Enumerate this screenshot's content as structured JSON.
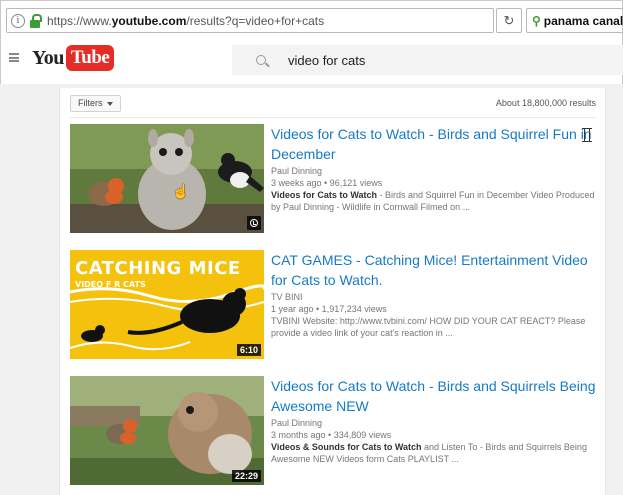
{
  "browser": {
    "url_prefix": "https://www.",
    "url_domain": "youtube.com",
    "url_path": "/results?q=video+for+cats",
    "reload_glyph": "↻",
    "search_value": "panama canal",
    "icons": [
      "info-icon",
      "lock-icon",
      "reload-icon",
      "search-engine-icon"
    ]
  },
  "header": {
    "logo_you": "You",
    "logo_tube": "Tube",
    "search_query": "video for cats"
  },
  "toolbar": {
    "filters_label": "Filters",
    "results_count": "About 18,800,000 results"
  },
  "results": [
    {
      "title": "Videos for Cats to Watch - Birds and Squirrel Fun in December",
      "channel": "Paul Dinning",
      "meta": "3 weeks ago • 96,121 views",
      "desc_hl": "Videos for Cats to Watch",
      "desc_rest": " - Birds and Squirrel Fun in December Video Produced by Paul Dinning - Wildlife in Cornwall Filmed on ...",
      "duration": "",
      "thumb_text1": "",
      "thumb_text2": ""
    },
    {
      "title": "CAT GAMES - Catching Mice! Entertainment Video for Cats to Watch.",
      "channel": "TV BINI",
      "meta": "1 year ago • 1,917,234 views",
      "desc_hl": "",
      "desc_rest": "TVBINI Website: http://www.tvbini.com/ HOW DID YOUR CAT REACT? Please provide a video link of your cat's reaction in ...",
      "duration": "6:10",
      "thumb_text1": "CATCHING MICE",
      "thumb_text2": "VIDEO F R CATS"
    },
    {
      "title": "Videos for Cats to Watch - Birds and Squirrels Being Awesome NEW",
      "channel": "Paul Dinning",
      "meta": "3 months ago • 334,809 views",
      "desc_hl": "Videos & Sounds for Cats to Watch",
      "desc_rest": " and Listen To - Birds and Squirrels Being Awesome NEW Videos form Cats PLAYLIST ...",
      "duration": "22:29",
      "thumb_text1": "",
      "thumb_text2": ""
    }
  ]
}
